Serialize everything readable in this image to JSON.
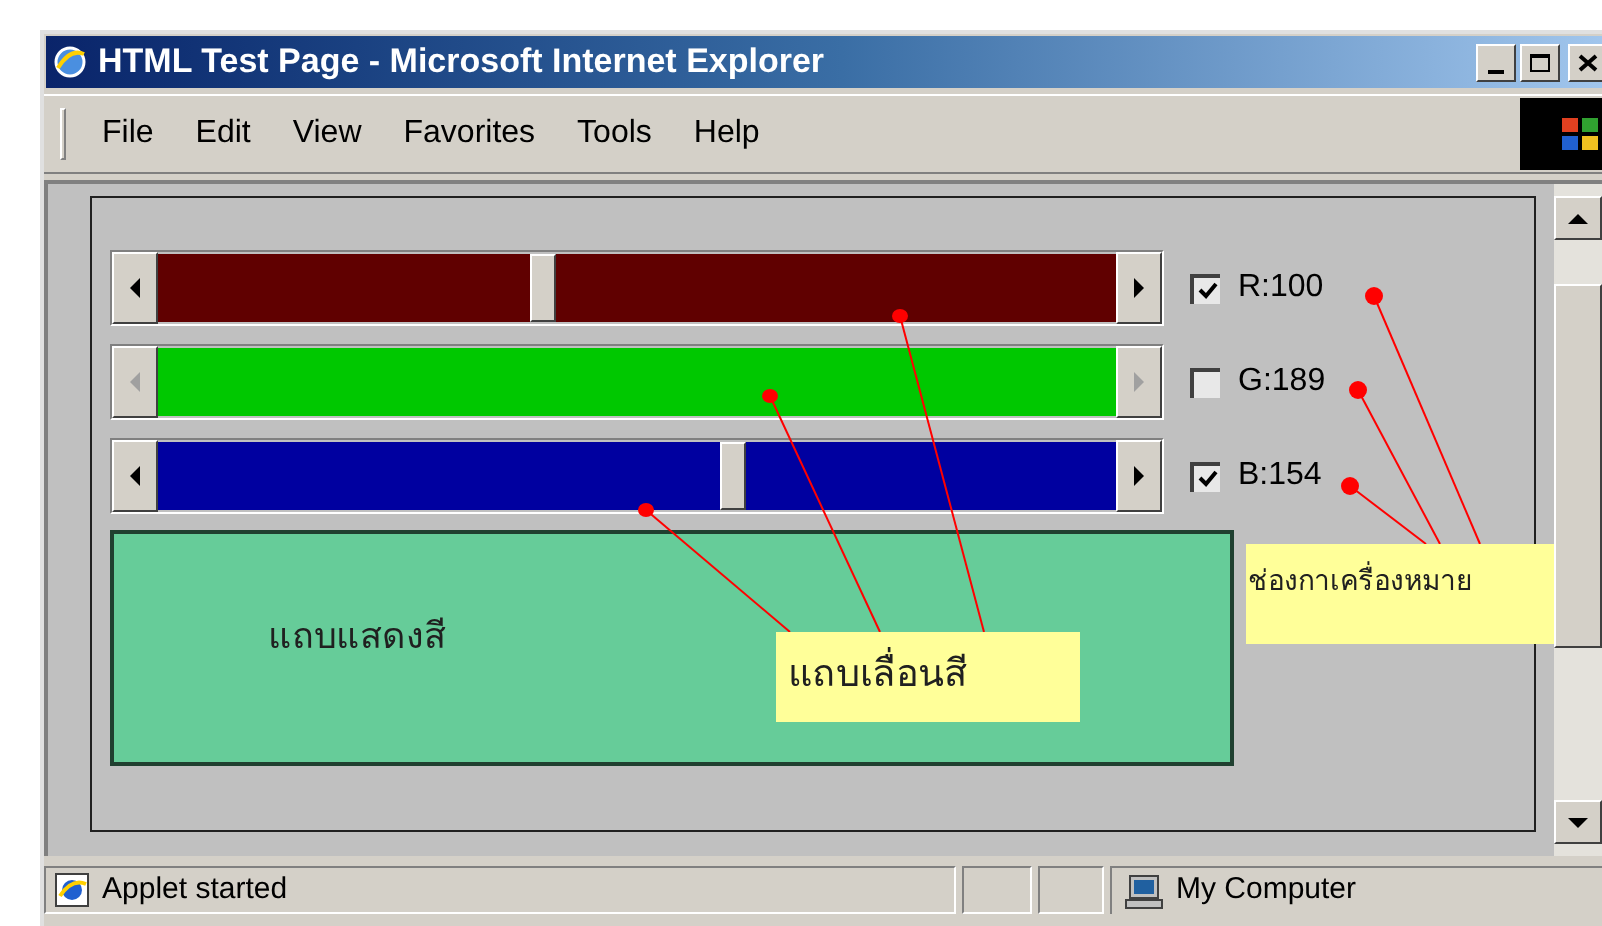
{
  "window": {
    "title": "HTML Test Page - Microsoft Internet Explorer"
  },
  "menu": [
    "File",
    "Edit",
    "View",
    "Favorites",
    "Tools",
    "Help"
  ],
  "channels": [
    {
      "label": "R:100",
      "checked": true,
      "color": "#600000",
      "level": 0.4
    },
    {
      "label": "G:189",
      "checked": false,
      "color": "#00c800"
    },
    {
      "label": "B:154",
      "checked": true,
      "color": "#0000a0",
      "level": 0.6
    }
  ],
  "preview": {
    "label": "แถบแสดงสี"
  },
  "annotations": [
    {
      "text": "แถบเลื่อนสี"
    },
    {
      "text": "ช่องกาเครื่องหมาย"
    }
  ],
  "status_bar": {
    "message": "Applet started",
    "zone": "My Computer"
  }
}
